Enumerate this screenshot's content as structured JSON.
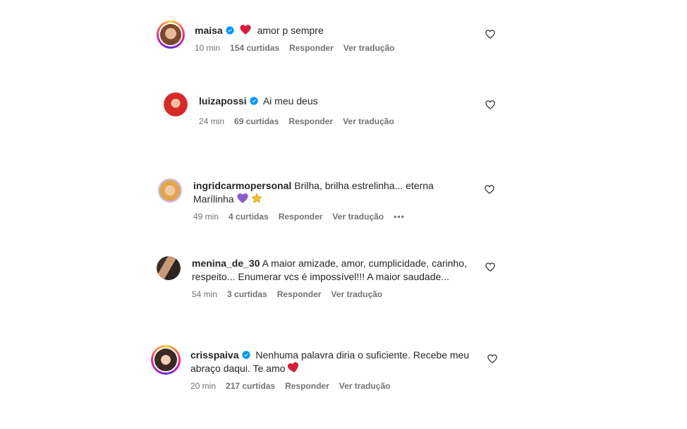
{
  "comments": [
    {
      "username": "maisa",
      "text": "amor p sempre",
      "time": "10 min",
      "likes": "154 curtidas",
      "reply": "Responder",
      "translate": "Ver tradução"
    },
    {
      "username": "luizapossi",
      "text": "Ai meu deus",
      "time": "24 min",
      "likes": "69 curtidas",
      "reply": "Responder",
      "translate": "Ver tradução"
    },
    {
      "username": "ingridcarmopersonal",
      "text": "Brilha, brilha estrelinha... eterna",
      "text2": "Marílinha",
      "time": "49 min",
      "likes": "4 curtidas",
      "reply": "Responder",
      "translate": "Ver tradução",
      "more": "•••"
    },
    {
      "username": "menina_de_30",
      "text": "A maior amizade, amor, cumplicidade, carinho,",
      "text2": "respeito... Enumerar vcs é impossível!!! A maior saudade...",
      "time": "54 min",
      "likes": "3 curtidas",
      "reply": "Responder",
      "translate": "Ver tradução"
    },
    {
      "username": "crisspaiva",
      "text": "Nenhuma palavra diria o suficiente. Recebe meu",
      "text2": "abraço daqui. Te amo",
      "time": "20 min",
      "likes": "217 curtidas",
      "reply": "Responder",
      "translate": "Ver tradução"
    }
  ],
  "icons": {
    "verified": "verified-badge-icon",
    "like": "heart-outline-icon"
  },
  "colors": {
    "verified": "#0095f6",
    "meta": "#737373",
    "heart_red": "#e0245e",
    "purple_heart": "#8a5cd0",
    "star": "#f5c518"
  }
}
